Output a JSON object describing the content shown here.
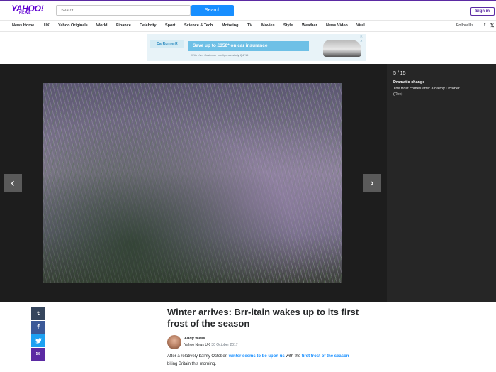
{
  "header": {
    "logo_main": "YAHOO!",
    "logo_sub": "NEWS",
    "search_placeholder": "Search",
    "search_button": "Search",
    "signin": "Sign in"
  },
  "nav": {
    "items": [
      "News Home",
      "UK",
      "Yahoo Originals",
      "World",
      "Finance",
      "Celebrity",
      "Sport",
      "Science & Tech",
      "Motoring",
      "TV",
      "Movies",
      "Style",
      "Weather",
      "News Video",
      "Viral"
    ],
    "follow_label": "Follow Us",
    "social": [
      "f",
      "𝕏"
    ]
  },
  "ad": {
    "logo_text": "CarRunnerR",
    "banner_text": "Save up to £350* on car insurance",
    "fine_print": "With LV=, Customer Intelligence study Q4 '15",
    "close": "ⓘ ✕"
  },
  "gallery": {
    "counter": "5 / 15",
    "caption_title": "Dramatic change",
    "caption_text": "The frost comes after a balmy October.",
    "caption_credit": "(Rex)",
    "prev_icon": "‹",
    "next_icon": "›"
  },
  "share": [
    "t",
    "f",
    "",
    "✉"
  ],
  "article": {
    "headline": "Winter arrives: Brr-itain wakes up to its first frost of the season",
    "author": "Andy Wells",
    "source": "Yahoo News UK",
    "date": "30 October 2017",
    "body_1": "After a relatively balmy October, ",
    "link_1": "winter seems to be upon us",
    "body_2": " with the ",
    "link_2": "first frost of the season",
    "body_3": " biting Britain this morning."
  },
  "colors": {
    "brand": "#6001d2",
    "search_button": "#188fff",
    "twitter": "#1da1f2",
    "tumblr": "#36465d",
    "facebook": "#3b5998",
    "mail": "#5b2aa3"
  }
}
